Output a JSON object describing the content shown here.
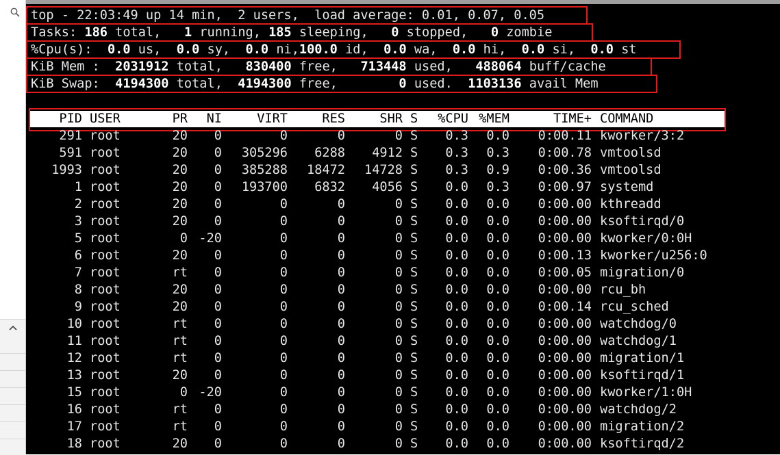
{
  "summary": {
    "uptime_line": "top - 22:03:49 up 14 min,  2 users,  load average: 0.01, 0.07, 0.05",
    "tasks": {
      "label": "Tasks:",
      "total": "186",
      "total_label": "total,",
      "running": "1",
      "running_label": "running,",
      "sleeping": "185",
      "sleeping_label": "sleeping,",
      "stopped": "0",
      "stopped_label": "stopped,",
      "zombie": "0",
      "zombie_label": "zombie"
    },
    "cpu": {
      "label": "%Cpu(s):",
      "us": "0.0",
      "us_label": "us,",
      "sy": "0.0",
      "sy_label": "sy,",
      "ni": "0.0",
      "ni_label": "ni,",
      "id": "100.0",
      "id_label": "id,",
      "wa": "0.0",
      "wa_label": "wa,",
      "hi": "0.0",
      "hi_label": "hi,",
      "si": "0.0",
      "si_label": "si,",
      "st": "0.0",
      "st_label": "st"
    },
    "mem": {
      "label": "KiB Mem :",
      "total": "2031912",
      "total_label": "total,",
      "free": "830400",
      "free_label": "free,",
      "used": "713448",
      "used_label": "used,",
      "buff": "488064",
      "buff_label": "buff/cache"
    },
    "swap": {
      "label": "KiB Swap:",
      "total": "4194300",
      "total_label": "total,",
      "free": "4194300",
      "free_label": "free,",
      "used": "0",
      "used_label": "used.",
      "avail": "1103136",
      "avail_label": "avail Mem"
    }
  },
  "table": {
    "columns": [
      "PID",
      "USER",
      "PR",
      "NI",
      "VIRT",
      "RES",
      "SHR",
      "S",
      "%CPU",
      "%MEM",
      "TIME+",
      "COMMAND"
    ],
    "rows": [
      [
        "291",
        "root",
        "20",
        "0",
        "0",
        "0",
        "0",
        "S",
        "0.3",
        "0.0",
        "0:00.11",
        "kworker/3:2"
      ],
      [
        "591",
        "root",
        "20",
        "0",
        "305296",
        "6288",
        "4912",
        "S",
        "0.3",
        "0.3",
        "0:00.78",
        "vmtoolsd"
      ],
      [
        "1993",
        "root",
        "20",
        "0",
        "385288",
        "18472",
        "14728",
        "S",
        "0.3",
        "0.9",
        "0:00.36",
        "vmtoolsd"
      ],
      [
        "1",
        "root",
        "20",
        "0",
        "193700",
        "6832",
        "4056",
        "S",
        "0.0",
        "0.3",
        "0:00.97",
        "systemd"
      ],
      [
        "2",
        "root",
        "20",
        "0",
        "0",
        "0",
        "0",
        "S",
        "0.0",
        "0.0",
        "0:00.00",
        "kthreadd"
      ],
      [
        "3",
        "root",
        "20",
        "0",
        "0",
        "0",
        "0",
        "S",
        "0.0",
        "0.0",
        "0:00.00",
        "ksoftirqd/0"
      ],
      [
        "5",
        "root",
        "0",
        "-20",
        "0",
        "0",
        "0",
        "S",
        "0.0",
        "0.0",
        "0:00.00",
        "kworker/0:0H"
      ],
      [
        "6",
        "root",
        "20",
        "0",
        "0",
        "0",
        "0",
        "S",
        "0.0",
        "0.0",
        "0:00.13",
        "kworker/u256:0"
      ],
      [
        "7",
        "root",
        "rt",
        "0",
        "0",
        "0",
        "0",
        "S",
        "0.0",
        "0.0",
        "0:00.05",
        "migration/0"
      ],
      [
        "8",
        "root",
        "20",
        "0",
        "0",
        "0",
        "0",
        "S",
        "0.0",
        "0.0",
        "0:00.00",
        "rcu_bh"
      ],
      [
        "9",
        "root",
        "20",
        "0",
        "0",
        "0",
        "0",
        "S",
        "0.0",
        "0.0",
        "0:00.14",
        "rcu_sched"
      ],
      [
        "10",
        "root",
        "rt",
        "0",
        "0",
        "0",
        "0",
        "S",
        "0.0",
        "0.0",
        "0:00.00",
        "watchdog/0"
      ],
      [
        "11",
        "root",
        "rt",
        "0",
        "0",
        "0",
        "0",
        "S",
        "0.0",
        "0.0",
        "0:00.00",
        "watchdog/1"
      ],
      [
        "12",
        "root",
        "rt",
        "0",
        "0",
        "0",
        "0",
        "S",
        "0.0",
        "0.0",
        "0:00.00",
        "migration/1"
      ],
      [
        "13",
        "root",
        "20",
        "0",
        "0",
        "0",
        "0",
        "S",
        "0.0",
        "0.0",
        "0:00.00",
        "ksoftirqd/1"
      ],
      [
        "15",
        "root",
        "0",
        "-20",
        "0",
        "0",
        "0",
        "S",
        "0.0",
        "0.0",
        "0:00.00",
        "kworker/1:0H"
      ],
      [
        "16",
        "root",
        "rt",
        "0",
        "0",
        "0",
        "0",
        "S",
        "0.0",
        "0.0",
        "0:00.00",
        "watchdog/2"
      ],
      [
        "17",
        "root",
        "rt",
        "0",
        "0",
        "0",
        "0",
        "S",
        "0.0",
        "0.0",
        "0:00.00",
        "migration/2"
      ],
      [
        "18",
        "root",
        "20",
        "0",
        "0",
        "0",
        "0",
        "S",
        "0.0",
        "0.0",
        "0:00.00",
        "ksoftirqd/2"
      ]
    ]
  },
  "colors": {
    "terminal_bg": "#000000",
    "terminal_fg": "#e6e6e6",
    "header_bg": "#ffffff",
    "highlight_border": "#e01b1b"
  },
  "icons": {
    "sidebar_search": "search-icon",
    "sidebar_scroll": "chevron-up-icon"
  }
}
